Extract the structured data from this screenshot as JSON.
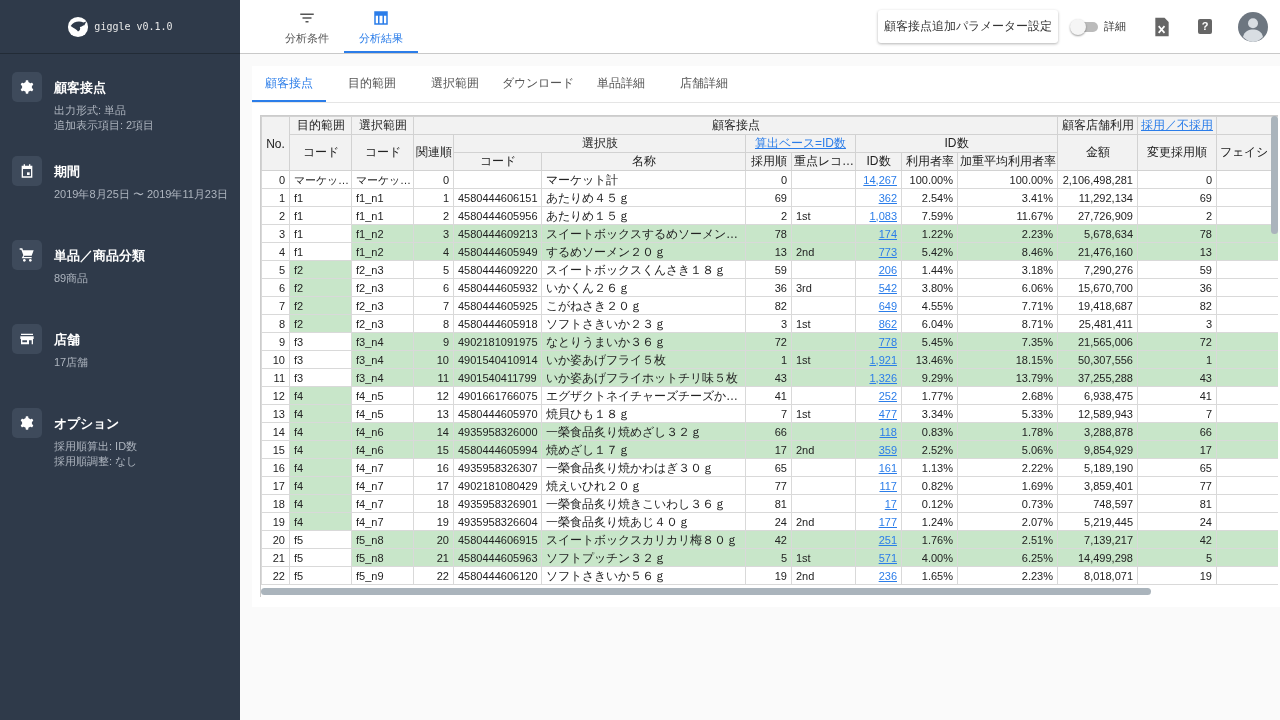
{
  "sidebar": {
    "logo": "giggle v0.1.0",
    "items": [
      {
        "kind": "gear",
        "title": "顧客接点",
        "lines": [
          "出力形式: 単品",
          "追加表示項目: 2項目"
        ]
      },
      {
        "kind": "calendar",
        "title": "期間",
        "lines": [
          "2019年8月25日 〜 2019年11月23日"
        ]
      },
      {
        "kind": "cart",
        "title": "単品／商品分類",
        "lines": [
          "89商品"
        ]
      },
      {
        "kind": "store",
        "title": "店舗",
        "lines": [
          "17店舗"
        ]
      },
      {
        "kind": "gear",
        "title": "オプション",
        "lines": [
          "採用順算出: ID数",
          "採用順調整: なし"
        ]
      }
    ]
  },
  "top_tabs": [
    {
      "kind": "filter",
      "label": "分析条件",
      "selected": false
    },
    {
      "kind": "table",
      "label": "分析結果",
      "selected": true
    }
  ],
  "toolbar": {
    "settings_button": "顧客接点追加パラメーター設定",
    "detail_toggle": {
      "label": "詳細",
      "on": false
    },
    "help": "?"
  },
  "content_tabs": [
    {
      "label": "顧客接点",
      "selected": true
    },
    {
      "label": "目的範囲",
      "selected": false
    },
    {
      "label": "選択範囲",
      "selected": false
    },
    {
      "label": "ダウンロード",
      "selected": false
    },
    {
      "label": "単品詳細",
      "selected": false
    },
    {
      "label": "店舗詳細",
      "selected": false
    }
  ],
  "table": {
    "header_rows": [
      [
        {
          "text": "No."
        },
        {
          "text": "目的範囲"
        },
        {
          "text": "選択範囲"
        },
        {
          "text": "顧客接点"
        },
        {
          "text": "顧客店舗利用"
        },
        {
          "text": "採用／不採用",
          "kind": "link"
        }
      ],
      [
        {
          "text": "コード"
        },
        {
          "text": "コード"
        },
        {
          "text": "関連順"
        },
        {
          "text": "選択肢"
        },
        {
          "text": "算出ベース=ID数",
          "kind": "link"
        },
        {
          "text": "ID数"
        },
        {
          "text": "金額"
        },
        {
          "text": "変更採用順"
        },
        {
          "text": "フェイシ"
        }
      ],
      [
        {
          "text": "コード"
        },
        {
          "text": "名称"
        },
        {
          "text": "採用順"
        },
        {
          "text": "重点レコ…"
        },
        {
          "text": "ID数"
        },
        {
          "text": "利用者率"
        },
        {
          "text": "加重平均利用者率"
        }
      ]
    ],
    "rows": [
      {
        "no": "0",
        "target_code": "マーケッ…",
        "selection_code": "マーケッ…",
        "relation_order": "0",
        "name": "マーケット計",
        "adoption_order": "0",
        "id_count": "14,267",
        "user_rate": "100.00%",
        "weighted_rate": "100.00%",
        "amount": "2,106,498,281",
        "changed_order": "0",
        "target_highlighted": false,
        "selection_highlighted": false
      },
      {
        "no": "1",
        "target_code": "f1",
        "selection_code": "f1_n1",
        "relation_order": "1",
        "code": "4580444606151",
        "name": "あたりめ４５ｇ",
        "adoption_order": "69",
        "id_count": "362",
        "user_rate": "2.54%",
        "weighted_rate": "3.41%",
        "amount": "11,292,134",
        "changed_order": "69",
        "target_highlighted": false,
        "selection_highlighted": false
      },
      {
        "no": "2",
        "target_code": "f1",
        "selection_code": "f1_n1",
        "relation_order": "2",
        "code": "4580444605956",
        "name": "あたりめ１５ｇ",
        "adoption_order": "2",
        "priority": "1st",
        "id_count": "1,083",
        "user_rate": "7.59%",
        "weighted_rate": "11.67%",
        "amount": "27,726,909",
        "changed_order": "2",
        "target_highlighted": false,
        "selection_highlighted": false
      },
      {
        "no": "3",
        "target_code": "f1",
        "selection_code": "f1_n2",
        "relation_order": "3",
        "code": "4580444609213",
        "name": "スイートボックスするめソーメン…",
        "adoption_order": "78",
        "id_count": "174",
        "user_rate": "1.22%",
        "weighted_rate": "2.23%",
        "amount": "5,678,634",
        "changed_order": "78",
        "target_highlighted": false,
        "selection_highlighted": true
      },
      {
        "no": "4",
        "target_code": "f1",
        "selection_code": "f1_n2",
        "relation_order": "4",
        "code": "4580444605949",
        "name": "するめソーメン２０ｇ",
        "adoption_order": "13",
        "priority": "2nd",
        "id_count": "773",
        "user_rate": "5.42%",
        "weighted_rate": "8.46%",
        "amount": "21,476,160",
        "changed_order": "13",
        "target_highlighted": false,
        "selection_highlighted": true
      },
      {
        "no": "5",
        "target_code": "f2",
        "selection_code": "f2_n3",
        "relation_order": "5",
        "code": "4580444609220",
        "name": "スイートボックスくんさき１８ｇ",
        "adoption_order": "59",
        "id_count": "206",
        "user_rate": "1.44%",
        "weighted_rate": "3.18%",
        "amount": "7,290,276",
        "changed_order": "59",
        "target_highlighted": true,
        "selection_highlighted": false
      },
      {
        "no": "6",
        "target_code": "f2",
        "selection_code": "f2_n3",
        "relation_order": "6",
        "code": "4580444605932",
        "name": "いかくん２６ｇ",
        "adoption_order": "36",
        "priority": "3rd",
        "id_count": "542",
        "user_rate": "3.80%",
        "weighted_rate": "6.06%",
        "amount": "15,670,700",
        "changed_order": "36",
        "target_highlighted": true,
        "selection_highlighted": false
      },
      {
        "no": "7",
        "target_code": "f2",
        "selection_code": "f2_n3",
        "relation_order": "7",
        "code": "4580444605925",
        "name": "こがねさき２０ｇ",
        "adoption_order": "82",
        "id_count": "649",
        "user_rate": "4.55%",
        "weighted_rate": "7.71%",
        "amount": "19,418,687",
        "changed_order": "82",
        "target_highlighted": true,
        "selection_highlighted": false
      },
      {
        "no": "8",
        "target_code": "f2",
        "selection_code": "f2_n3",
        "relation_order": "8",
        "code": "4580444605918",
        "name": "ソフトさきいか２３ｇ",
        "adoption_order": "3",
        "priority": "1st",
        "id_count": "862",
        "user_rate": "6.04%",
        "weighted_rate": "8.71%",
        "amount": "25,481,411",
        "changed_order": "3",
        "target_highlighted": true,
        "selection_highlighted": false
      },
      {
        "no": "9",
        "target_code": "f3",
        "selection_code": "f3_n4",
        "relation_order": "9",
        "code": "4902181091975",
        "name": "なとりうまいか３６ｇ",
        "adoption_order": "72",
        "id_count": "778",
        "user_rate": "5.45%",
        "weighted_rate": "7.35%",
        "amount": "21,565,006",
        "changed_order": "72",
        "target_highlighted": false,
        "selection_highlighted": true
      },
      {
        "no": "10",
        "target_code": "f3",
        "selection_code": "f3_n4",
        "relation_order": "10",
        "code": "4901540410914",
        "name": "いか姿あげフライ５枚",
        "adoption_order": "1",
        "priority": "1st",
        "id_count": "1,921",
        "user_rate": "13.46%",
        "weighted_rate": "18.15%",
        "amount": "50,307,556",
        "changed_order": "1",
        "target_highlighted": false,
        "selection_highlighted": true
      },
      {
        "no": "11",
        "target_code": "f3",
        "selection_code": "f3_n4",
        "relation_order": "11",
        "code": "4901540411799",
        "name": "いか姿あげフライホットチリ味５枚",
        "adoption_order": "43",
        "id_count": "1,326",
        "user_rate": "9.29%",
        "weighted_rate": "13.79%",
        "amount": "37,255,288",
        "changed_order": "43",
        "target_highlighted": false,
        "selection_highlighted": true
      },
      {
        "no": "12",
        "target_code": "f4",
        "selection_code": "f4_n5",
        "relation_order": "12",
        "code": "4901661766075",
        "name": "エグザクトネイチャーズチーズか…",
        "adoption_order": "41",
        "id_count": "252",
        "user_rate": "1.77%",
        "weighted_rate": "2.68%",
        "amount": "6,938,475",
        "changed_order": "41",
        "target_highlighted": true,
        "selection_highlighted": false
      },
      {
        "no": "13",
        "target_code": "f4",
        "selection_code": "f4_n5",
        "relation_order": "13",
        "code": "4580444605970",
        "name": "焼貝ひも１８ｇ",
        "adoption_order": "7",
        "priority": "1st",
        "id_count": "477",
        "user_rate": "3.34%",
        "weighted_rate": "5.33%",
        "amount": "12,589,943",
        "changed_order": "7",
        "target_highlighted": true,
        "selection_highlighted": false
      },
      {
        "no": "14",
        "target_code": "f4",
        "selection_code": "f4_n6",
        "relation_order": "14",
        "code": "4935958326000",
        "name": "一榮食品炙り焼めざし３２ｇ",
        "adoption_order": "66",
        "id_count": "118",
        "user_rate": "0.83%",
        "weighted_rate": "1.78%",
        "amount": "3,288,878",
        "changed_order": "66",
        "target_highlighted": true,
        "selection_highlighted": true
      },
      {
        "no": "15",
        "target_code": "f4",
        "selection_code": "f4_n6",
        "relation_order": "15",
        "code": "4580444605994",
        "name": "焼めざし１７ｇ",
        "adoption_order": "17",
        "priority": "2nd",
        "id_count": "359",
        "user_rate": "2.52%",
        "weighted_rate": "5.06%",
        "amount": "9,854,929",
        "changed_order": "17",
        "target_highlighted": true,
        "selection_highlighted": true
      },
      {
        "no": "16",
        "target_code": "f4",
        "selection_code": "f4_n7",
        "relation_order": "16",
        "code": "4935958326307",
        "name": "一榮食品炙り焼かわはぎ３０ｇ",
        "adoption_order": "65",
        "id_count": "161",
        "user_rate": "1.13%",
        "weighted_rate": "2.22%",
        "amount": "5,189,190",
        "changed_order": "65",
        "target_highlighted": true,
        "selection_highlighted": false
      },
      {
        "no": "17",
        "target_code": "f4",
        "selection_code": "f4_n7",
        "relation_order": "17",
        "code": "4902181080429",
        "name": "焼えいひれ２０ｇ",
        "adoption_order": "77",
        "id_count": "117",
        "user_rate": "0.82%",
        "weighted_rate": "1.69%",
        "amount": "3,859,401",
        "changed_order": "77",
        "target_highlighted": true,
        "selection_highlighted": false
      },
      {
        "no": "18",
        "target_code": "f4",
        "selection_code": "f4_n7",
        "relation_order": "18",
        "code": "4935958326901",
        "name": "一榮食品炙り焼きこいわし３６ｇ",
        "adoption_order": "81",
        "id_count": "17",
        "user_rate": "0.12%",
        "weighted_rate": "0.73%",
        "amount": "748,597",
        "changed_order": "81",
        "target_highlighted": true,
        "selection_highlighted": false
      },
      {
        "no": "19",
        "target_code": "f4",
        "selection_code": "f4_n7",
        "relation_order": "19",
        "code": "4935958326604",
        "name": "一榮食品炙り焼あじ４０ｇ",
        "adoption_order": "24",
        "priority": "2nd",
        "id_count": "177",
        "user_rate": "1.24%",
        "weighted_rate": "2.07%",
        "amount": "5,219,445",
        "changed_order": "24",
        "target_highlighted": true,
        "selection_highlighted": false
      },
      {
        "no": "20",
        "target_code": "f5",
        "selection_code": "f5_n8",
        "relation_order": "20",
        "code": "4580444606915",
        "name": "スイートボックスカリカリ梅８０ｇ",
        "adoption_order": "42",
        "id_count": "251",
        "user_rate": "1.76%",
        "weighted_rate": "2.51%",
        "amount": "7,139,217",
        "changed_order": "42",
        "target_highlighted": false,
        "selection_highlighted": true
      },
      {
        "no": "21",
        "target_code": "f5",
        "selection_code": "f5_n8",
        "relation_order": "21",
        "code": "4580444605963",
        "name": "ソフトプッチン３２ｇ",
        "adoption_order": "5",
        "priority": "1st",
        "id_count": "571",
        "user_rate": "4.00%",
        "weighted_rate": "6.25%",
        "amount": "14,499,298",
        "changed_order": "5",
        "target_highlighted": false,
        "selection_highlighted": true
      },
      {
        "no": "22",
        "target_code": "f5",
        "selection_code": "f5_n9",
        "relation_order": "22",
        "code": "4580444606120",
        "name": "ソフトさきいか５６ｇ",
        "adoption_order": "19",
        "priority": "2nd",
        "id_count": "236",
        "user_rate": "1.65%",
        "weighted_rate": "2.23%",
        "amount": "8,018,071",
        "changed_order": "19",
        "target_highlighted": false,
        "selection_highlighted": false
      }
    ]
  }
}
